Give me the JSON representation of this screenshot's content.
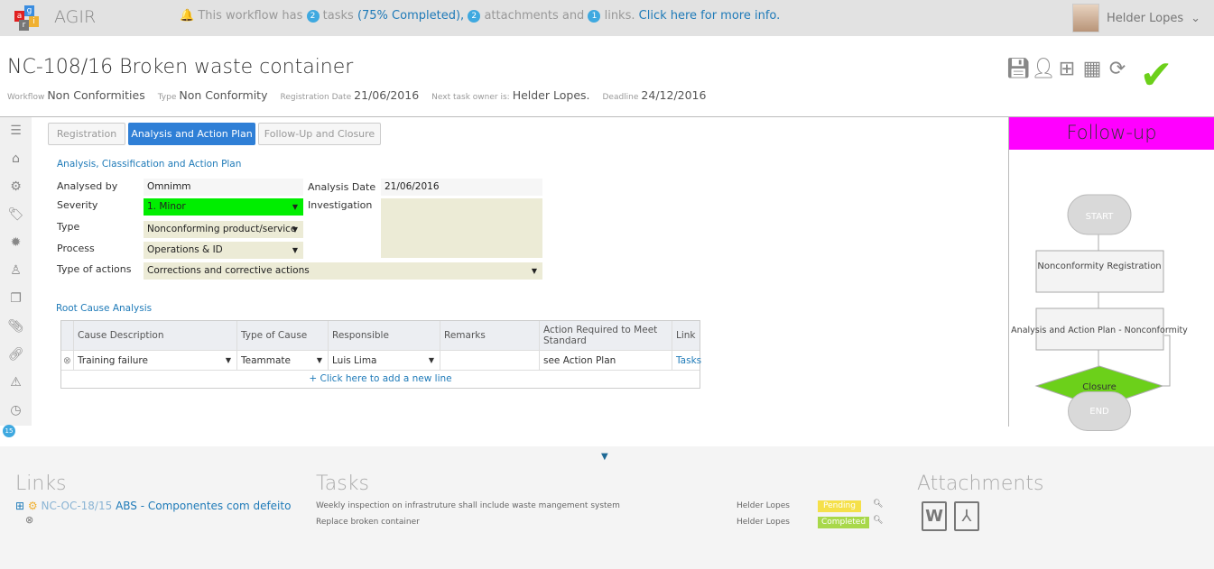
{
  "topbar": {
    "app_name": "AGIR",
    "logo_letters": [
      "a",
      "g",
      "r",
      "i"
    ],
    "notice": {
      "pre": "This workflow has",
      "tasks_count": "2",
      "tasks_text": "tasks",
      "completed": "(75% Completed),",
      "attachments_count": "2",
      "attachments_text": "attachments and",
      "links_count": "1",
      "links_text": "links.",
      "more_info": "Click here for more info."
    },
    "user": "Helder Lopes"
  },
  "header": {
    "title": "NC-108/16 Broken waste container",
    "meta": [
      {
        "label": "Workflow",
        "value": "Non Conformities"
      },
      {
        "label": "Type",
        "value": "Non Conformity"
      },
      {
        "label": "Registration Date",
        "value": "21/06/2016"
      },
      {
        "label": "Next task owner is:",
        "value": "Helder Lopes."
      },
      {
        "label": "Deadline",
        "value": "24/12/2016"
      }
    ]
  },
  "toolbar": [
    "save-icon",
    "user-icon",
    "sitemap-icon",
    "calendar-icon",
    "refresh-icon",
    "check-icon"
  ],
  "sidebar": {
    "icons": [
      "menu-icon",
      "home-icon",
      "cogs-icon",
      "tags-icon",
      "gear-icon",
      "users-icon",
      "documents-icon",
      "paperclip-icon",
      "link-icon",
      "warning-icon",
      "clock-icon",
      "star-icon"
    ],
    "badge": "15"
  },
  "tabs": [
    {
      "label": "Registration"
    },
    {
      "label": "Analysis and Action Plan",
      "active": true
    },
    {
      "label": "Follow-Up and Closure"
    }
  ],
  "form": {
    "section": "Analysis, Classification and Action Plan",
    "analysed_by": {
      "label": "Analysed by",
      "value": "Omnimm"
    },
    "severity": {
      "label": "Severity",
      "value": "1. Minor",
      "color": "#00ee00"
    },
    "type": {
      "label": "Type",
      "value": "Nonconforming product/service"
    },
    "process": {
      "label": "Process",
      "value": "Operations & ID"
    },
    "type_of_actions": {
      "label": "Type of actions",
      "value": "Corrections and corrective actions"
    },
    "analysis_date": {
      "label": "Analysis Date",
      "value": "21/06/2016"
    },
    "investigation": {
      "label": "Investigation",
      "value": ""
    }
  },
  "root_cause": {
    "title": "Root Cause Analysis",
    "columns": [
      "Cause Description",
      "Type of Cause",
      "Responsible",
      "Remarks",
      "Action Required to Meet Standard",
      "Link"
    ],
    "rows": [
      {
        "cause": "Training failure",
        "type": "Teammate",
        "responsible": "Luis Lima",
        "remarks": "",
        "action": "see Action Plan",
        "link": "Tasks"
      }
    ],
    "add_line": "+ Click here to add a new line"
  },
  "followup": {
    "title": "Follow-up",
    "nodes": [
      "START",
      "Nonconformity Registration",
      "Analysis and Action Plan - Nonconformity",
      "Closure",
      "END"
    ]
  },
  "bottom": {
    "links_title": "Links",
    "links": [
      {
        "code": "NC-OC-18/15",
        "text": "ABS - Componentes com defeito"
      }
    ],
    "tasks_title": "Tasks",
    "tasks": [
      {
        "name": "Weekly inspection on infrastruture shall include waste mangement system",
        "owner": "Helder Lopes",
        "status": "Pending",
        "color": "#f5e04a"
      },
      {
        "name": "Replace broken container",
        "owner": "Helder Lopes",
        "status": "Completed",
        "color": "#a8d84a"
      }
    ],
    "attachments_title": "Attachments",
    "attachments": [
      "word-icon",
      "pdf-icon"
    ]
  }
}
